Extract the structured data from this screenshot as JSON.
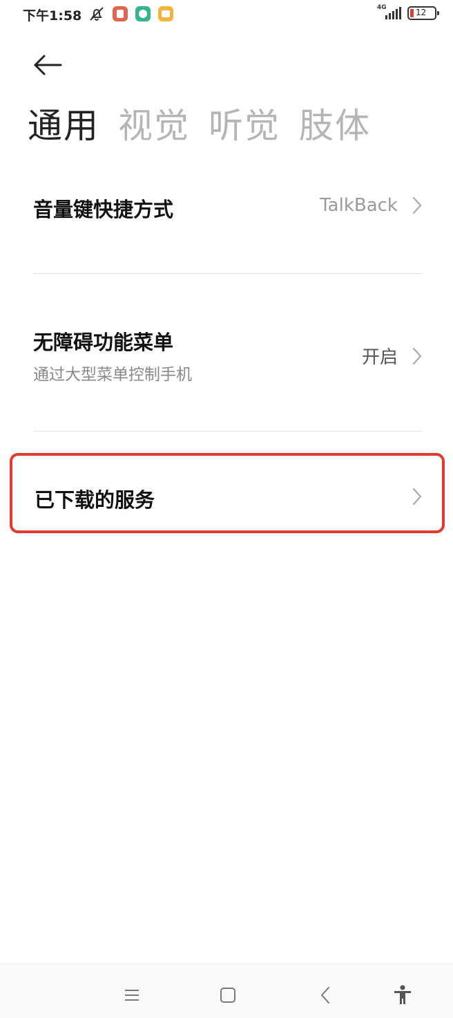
{
  "status_bar": {
    "time": "下午1:58",
    "network": "4G",
    "battery": "12",
    "icons": [
      "mute-icon",
      "app-red-icon",
      "app-green-icon",
      "app-yellow-icon"
    ]
  },
  "tabs": [
    {
      "label": "通用",
      "active": true
    },
    {
      "label": "视觉",
      "active": false
    },
    {
      "label": "听觉",
      "active": false
    },
    {
      "label": "肢体",
      "active": false
    }
  ],
  "settings": [
    {
      "title": "音量键快捷方式",
      "value": "TalkBack"
    },
    {
      "title": "无障碍功能菜单",
      "subtitle": "通过大型菜单控制手机",
      "value": "开启"
    },
    {
      "title": "已下载的服务"
    }
  ],
  "colors": {
    "highlight": "#e23a2b",
    "tab_inactive": "#b5b5b5",
    "tab_active": "#222222"
  },
  "nav": [
    "menu-icon",
    "home-icon",
    "back-icon",
    "accessibility-icon"
  ]
}
